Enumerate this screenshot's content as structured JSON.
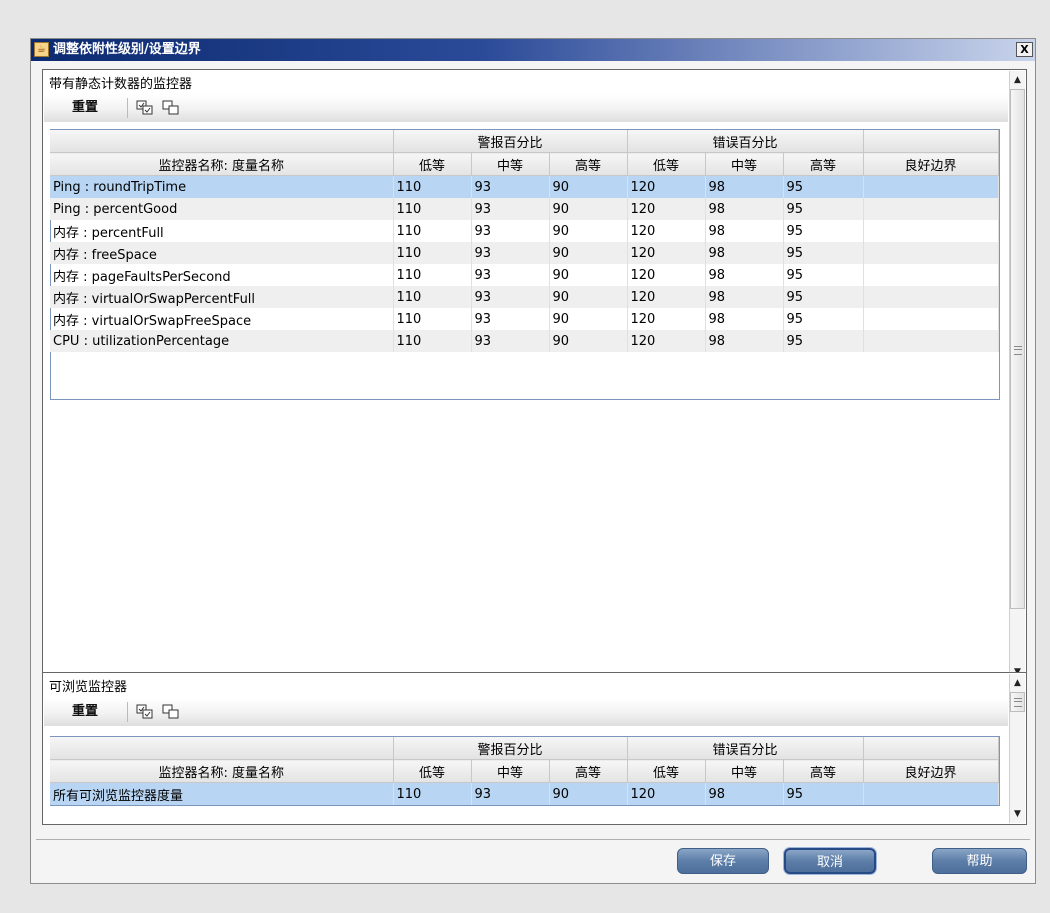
{
  "window": {
    "title": "调整依附性级别/设置边界",
    "close_label": "X"
  },
  "static_panel": {
    "title": "带有静态计数器的监控器",
    "toolbar": {
      "reset_label": "重置"
    },
    "table": {
      "group_headers": [
        "警报百分比",
        "错误百分比"
      ],
      "columns": [
        "监控器名称: 度量名称",
        "低等",
        "中等",
        "高等",
        "低等",
        "中等",
        "高等",
        "良好边界"
      ],
      "rows": [
        [
          "Ping : roundTripTime",
          "110",
          "93",
          "90",
          "120",
          "98",
          "95",
          ""
        ],
        [
          "Ping : percentGood",
          "110",
          "93",
          "90",
          "120",
          "98",
          "95",
          ""
        ],
        [
          "内存 : percentFull",
          "110",
          "93",
          "90",
          "120",
          "98",
          "95",
          ""
        ],
        [
          "内存 : freeSpace",
          "110",
          "93",
          "90",
          "120",
          "98",
          "95",
          ""
        ],
        [
          "内存 : pageFaultsPerSecond",
          "110",
          "93",
          "90",
          "120",
          "98",
          "95",
          ""
        ],
        [
          "内存 : virtualOrSwapPercentFull",
          "110",
          "93",
          "90",
          "120",
          "98",
          "95",
          ""
        ],
        [
          "内存 : virtualOrSwapFreeSpace",
          "110",
          "93",
          "90",
          "120",
          "98",
          "95",
          ""
        ],
        [
          "CPU : utilizationPercentage",
          "110",
          "93",
          "90",
          "120",
          "98",
          "95",
          ""
        ]
      ]
    }
  },
  "browsable_panel": {
    "title": "可浏览监控器",
    "toolbar": {
      "reset_label": "重置"
    },
    "table": {
      "group_headers": [
        "警报百分比",
        "错误百分比"
      ],
      "columns": [
        "监控器名称: 度量名称",
        "低等",
        "中等",
        "高等",
        "低等",
        "中等",
        "高等",
        "良好边界"
      ],
      "rows": [
        [
          "所有可浏览监控器度量",
          "110",
          "93",
          "90",
          "120",
          "98",
          "95",
          ""
        ]
      ]
    }
  },
  "buttons": {
    "save": "保存",
    "cancel": "取消",
    "help": "帮助"
  },
  "icons": {
    "select_all": "select-all-icon",
    "clear_selection": "clear-selection-icon",
    "app": "java-app-icon"
  },
  "colors": {
    "selection": "#b8d6f3",
    "title_bar": "#0c2a70",
    "button": "#5d7ea8"
  }
}
